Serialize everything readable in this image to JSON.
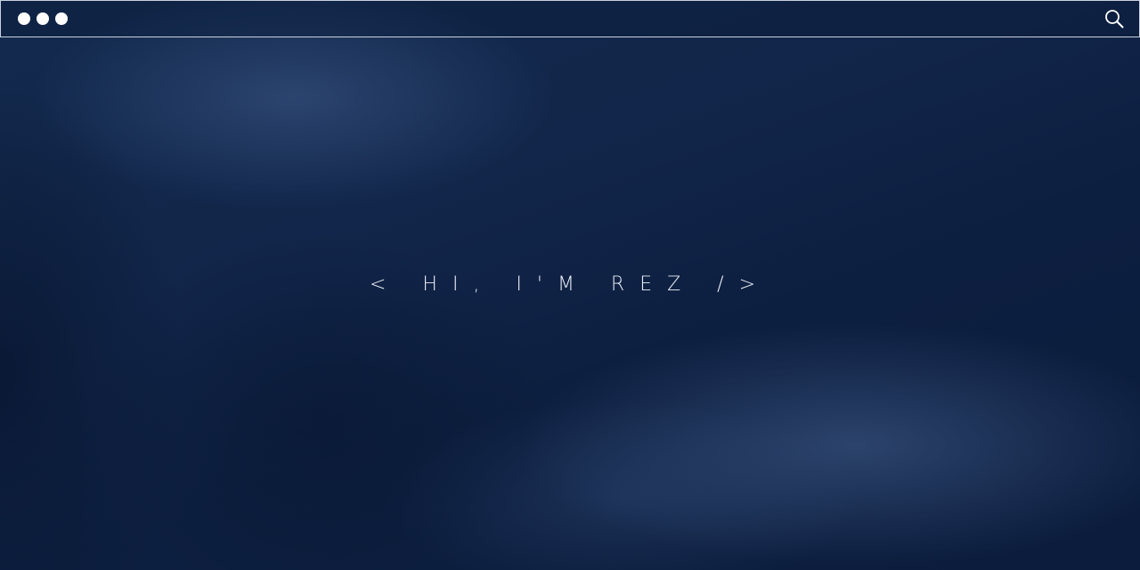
{
  "topbar": {
    "window_controls": [
      {
        "icon": "circle-dot-icon"
      },
      {
        "icon": "circle-dot-icon"
      },
      {
        "icon": "circle-dot-icon"
      }
    ],
    "search_icon": "search-icon"
  },
  "hero": {
    "heading": "< HI, I'M REZ />"
  },
  "colors": {
    "background": "#0d1f3f",
    "text": "#e9edf4",
    "topbar_border": "#c9d1dd"
  }
}
